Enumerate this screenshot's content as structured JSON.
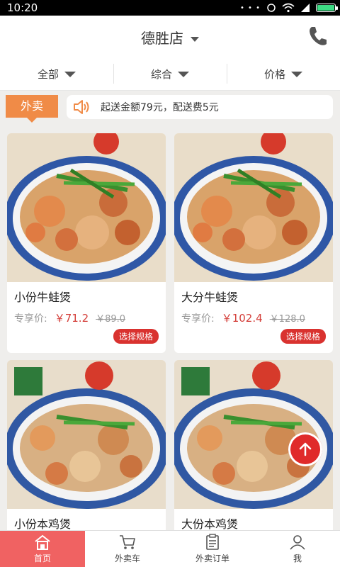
{
  "status_bar": {
    "time": "10:20"
  },
  "header": {
    "store_name": "德胜店"
  },
  "filters": [
    {
      "label": "全部"
    },
    {
      "label": "综合"
    },
    {
      "label": "价格"
    }
  ],
  "notice": {
    "tag": "外卖",
    "text": "起送金额79元，配送费5元"
  },
  "products": [
    {
      "name": "小份牛蛙煲",
      "price_label": "专享价:",
      "price": "￥71.2",
      "original_price": "￥89.0",
      "spec_button": "选择规格"
    },
    {
      "name": "大分牛蛙煲",
      "price_label": "专享价:",
      "price": "￥102.4",
      "original_price": "￥128.0",
      "spec_button": "选择规格"
    },
    {
      "name": "小份本鸡煲"
    },
    {
      "name": "大份本鸡煲"
    }
  ],
  "bottom_nav": [
    {
      "label": "首页",
      "icon": "home-icon",
      "active": true
    },
    {
      "label": "外卖车",
      "icon": "cart-icon"
    },
    {
      "label": "外卖订单",
      "icon": "order-icon"
    },
    {
      "label": "我",
      "icon": "user-icon"
    }
  ],
  "colors": {
    "accent": "#f06262",
    "price": "#d43f3a",
    "tag": "#f08b47",
    "spec": "#d9322f"
  }
}
